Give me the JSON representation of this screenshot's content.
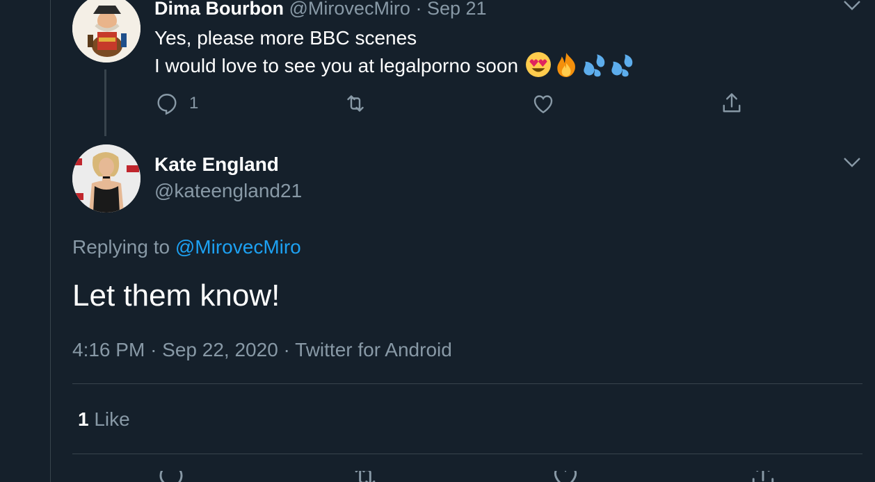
{
  "reply_tweet": {
    "author_name": "Dima Bourbon",
    "author_handle": "@MirovecMiro",
    "separator": "·",
    "date": "Sep 21",
    "line1": "Yes, please more BBC scenes",
    "line2": "I would love to see you at legalporno soon",
    "emojis": [
      "heart-eyes-emoji",
      "fire-emoji",
      "sweat-droplets-emoji",
      "sweat-droplets-emoji"
    ],
    "reply_count": "1"
  },
  "main_tweet": {
    "author_name": "Kate England",
    "author_handle": "@kateengland21",
    "replying_prefix": "Replying to",
    "replying_handle": "@MirovecMiro",
    "text": "Let them know!",
    "time": "4:16 PM",
    "sep1": "·",
    "date": "Sep 22, 2020",
    "sep2": "·",
    "source": "Twitter for Android",
    "like_count": "1",
    "like_label": "Like"
  },
  "colors": {
    "background": "#15202b",
    "text_primary": "#ffffff",
    "text_secondary": "#8899a6",
    "accent": "#1da1f2",
    "border": "#38444d"
  }
}
